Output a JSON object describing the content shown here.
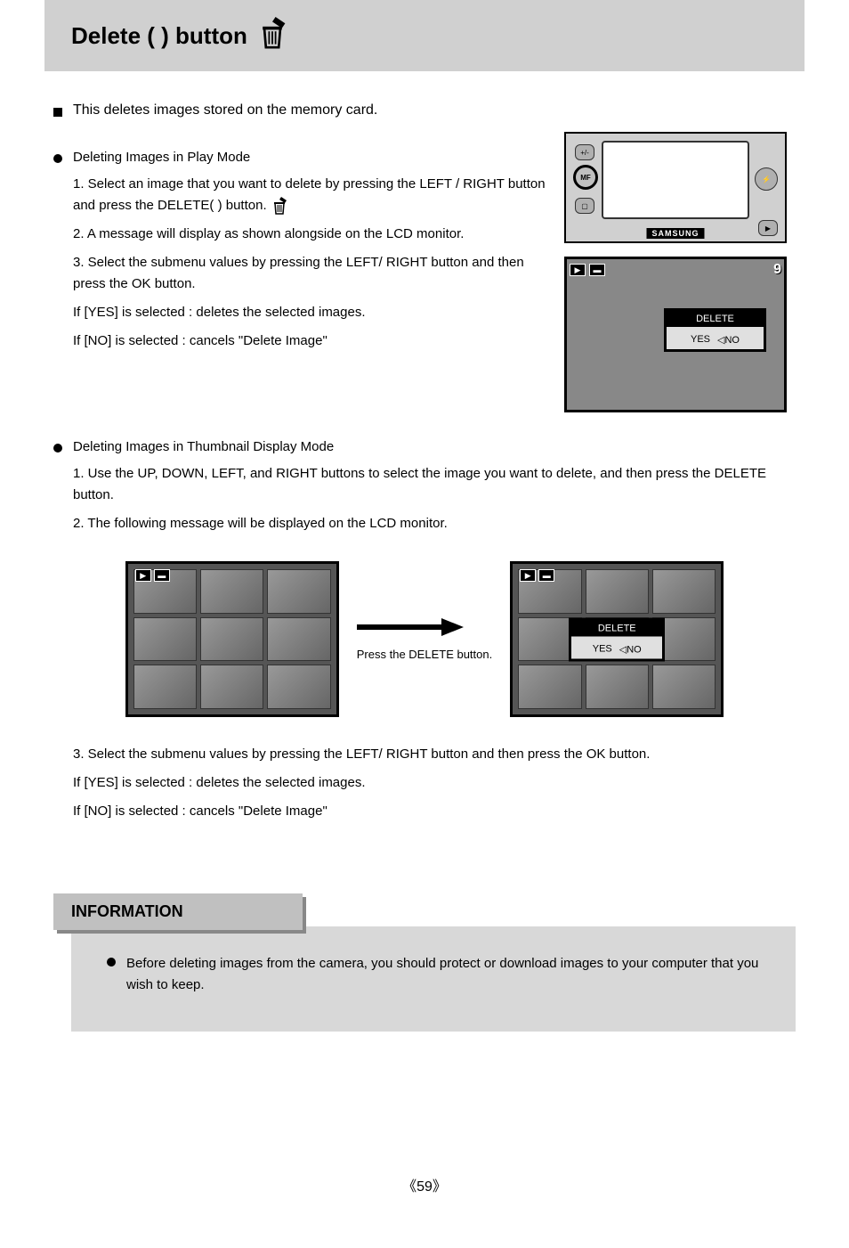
{
  "header": {
    "title": "Delete (       ) button"
  },
  "section": {
    "intro": "This deletes images stored on the memory card."
  },
  "single": {
    "title": "Deleting Images in Play Mode",
    "step1": "1. Select an image that you want to delete by pressing the LEFT / RIGHT button and press the DELETE(       ) button.",
    "step2": "2. A message will display as shown alongside on the LCD monitor.",
    "step3_intro": "3. Select the submenu values by pressing the LEFT/ RIGHT button and then press the OK button.",
    "step3_yes": "If [YES] is selected : deletes the selected images.",
    "step3_no": "If [NO] is selected : cancels \"Delete Image\""
  },
  "thumb": {
    "title": "Deleting Images in Thumbnail Display Mode",
    "step1": "1. Use the UP, DOWN, LEFT, and RIGHT buttons to select the image you want to delete, and then press the DELETE button.",
    "step2": "2. The following message will be displayed on the LCD monitor.",
    "step3_intro": "3. Select the submenu values by pressing the LEFT/ RIGHT button and then press the OK button.",
    "step3_yes": "If [YES] is selected : deletes the selected images.",
    "step3_no": "If [NO] is selected : cancels \"Delete Image\""
  },
  "caption": "Press the DELETE button.",
  "info": {
    "header": "INFORMATION",
    "text": "Before deleting images from the camera, you should protect or download images to your computer that you wish to keep."
  },
  "footer": {
    "page": "59"
  },
  "lcd": {
    "count": "9",
    "dialog_header": "DELETE",
    "dialog_opt1": "YES",
    "dialog_opt2": "NO",
    "tri": "◁"
  },
  "camera": {
    "brand": "SAMSUNG",
    "mf_btn": "MF"
  }
}
